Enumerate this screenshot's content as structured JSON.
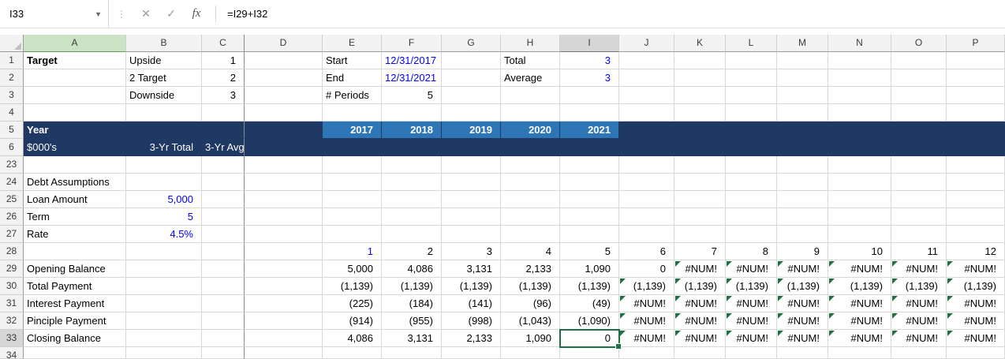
{
  "formula_bar": {
    "name_box": "I33",
    "separator_icon": "⋮",
    "cancel_icon": "✕",
    "enter_icon": "✓",
    "fx_icon": "fx",
    "formula": "=I29+I32"
  },
  "colors": {
    "banner": "#1F3864",
    "year_header": "#2E75B6",
    "input_blue": "#0000FF",
    "selection_green": "#1E7145",
    "error_flag_green": "#1E7145",
    "gridline": "#D8D8D8"
  },
  "sheet": {
    "columns": [
      "A",
      "B",
      "C",
      "D",
      "E",
      "F",
      "G",
      "H",
      "I",
      "J",
      "K",
      "L",
      "M",
      "N",
      "O",
      "P"
    ],
    "selected_cell": {
      "ref": "I33",
      "column": "I",
      "row": "33"
    },
    "highlighted_green_column": "A",
    "rows": [
      {
        "n": "1",
        "cells": [
          {
            "col": "A",
            "text": "Target",
            "cls": "b"
          },
          {
            "col": "B",
            "text": "Upside",
            "cls": ""
          },
          {
            "col": "C",
            "text": "1",
            "cls": "r"
          },
          {
            "col": "E",
            "text": "Start",
            "cls": ""
          },
          {
            "col": "F",
            "text": "12/31/2017",
            "cls": "r blu"
          },
          {
            "col": "H",
            "text": "Total",
            "cls": ""
          },
          {
            "col": "I",
            "text": "3",
            "cls": "r blu"
          }
        ]
      },
      {
        "n": "2",
        "cells": [
          {
            "col": "B",
            "text": "2 Target",
            "cls": ""
          },
          {
            "col": "C",
            "text": "2",
            "cls": "r"
          },
          {
            "col": "E",
            "text": "End",
            "cls": ""
          },
          {
            "col": "F",
            "text": "12/31/2021",
            "cls": "r blu"
          },
          {
            "col": "H",
            "text": "Average",
            "cls": ""
          },
          {
            "col": "I",
            "text": "3",
            "cls": "r blu"
          }
        ]
      },
      {
        "n": "3",
        "cells": [
          {
            "col": "B",
            "text": "Downside",
            "cls": ""
          },
          {
            "col": "C",
            "text": "3",
            "cls": "r"
          },
          {
            "col": "E",
            "text": "# Periods",
            "cls": ""
          },
          {
            "col": "F",
            "text": "5",
            "cls": "r"
          }
        ]
      },
      {
        "n": "4",
        "cells": []
      },
      {
        "n": "5",
        "row_cls": "banner",
        "cells": [
          {
            "col": "A",
            "text": "Year",
            "cls": "b w"
          },
          {
            "col": "E",
            "text": "2017",
            "cls": "year r b w"
          },
          {
            "col": "F",
            "text": "2018",
            "cls": "year r b w"
          },
          {
            "col": "G",
            "text": "2019",
            "cls": "year r b w"
          },
          {
            "col": "H",
            "text": "2020",
            "cls": "year r b w"
          },
          {
            "col": "I",
            "text": "2021",
            "cls": "year r b w"
          }
        ]
      },
      {
        "n": "6",
        "row_cls": "banner",
        "cells": [
          {
            "col": "A",
            "text": "$000's",
            "cls": "w"
          },
          {
            "col": "B",
            "text": "3-Yr Total",
            "cls": "r w"
          },
          {
            "col": "C",
            "text": "3-Yr Avg",
            "cls": "r w"
          }
        ]
      },
      {
        "n": "23",
        "cells": []
      },
      {
        "n": "24",
        "cells": [
          {
            "col": "A",
            "text": "Debt Assumptions",
            "cls": ""
          }
        ]
      },
      {
        "n": "25",
        "cells": [
          {
            "col": "A",
            "text": "Loan Amount",
            "cls": ""
          },
          {
            "col": "B",
            "text": "5,000",
            "cls": "r blu"
          }
        ]
      },
      {
        "n": "26",
        "cells": [
          {
            "col": "A",
            "text": "Term",
            "cls": ""
          },
          {
            "col": "B",
            "text": "5",
            "cls": "r blu"
          }
        ]
      },
      {
        "n": "27",
        "cells": [
          {
            "col": "A",
            "text": "Rate",
            "cls": ""
          },
          {
            "col": "B",
            "text": "4.5%",
            "cls": "r blu"
          }
        ]
      },
      {
        "n": "28",
        "cells": [
          {
            "col": "E",
            "text": "1",
            "cls": "r blu"
          },
          {
            "col": "F",
            "text": "2",
            "cls": "r"
          },
          {
            "col": "G",
            "text": "3",
            "cls": "r"
          },
          {
            "col": "H",
            "text": "4",
            "cls": "r"
          },
          {
            "col": "I",
            "text": "5",
            "cls": "r"
          },
          {
            "col": "J",
            "text": "6",
            "cls": "r"
          },
          {
            "col": "K",
            "text": "7",
            "cls": "r"
          },
          {
            "col": "L",
            "text": "8",
            "cls": "r"
          },
          {
            "col": "M",
            "text": "9",
            "cls": "r"
          },
          {
            "col": "N",
            "text": "10",
            "cls": "r"
          },
          {
            "col": "O",
            "text": "11",
            "cls": "r"
          },
          {
            "col": "P",
            "text": "12",
            "cls": "r"
          }
        ]
      },
      {
        "n": "29",
        "cells": [
          {
            "col": "A",
            "text": "Opening Balance",
            "cls": ""
          },
          {
            "col": "E",
            "text": "5,000",
            "cls": "r"
          },
          {
            "col": "F",
            "text": "4,086",
            "cls": "r"
          },
          {
            "col": "G",
            "text": "3,131",
            "cls": "r"
          },
          {
            "col": "H",
            "text": "2,133",
            "cls": "r"
          },
          {
            "col": "I",
            "text": "1,090",
            "cls": "r"
          },
          {
            "col": "J",
            "text": "0",
            "cls": "r"
          },
          {
            "col": "K",
            "text": "#NUM!",
            "cls": "r",
            "flag": true
          },
          {
            "col": "L",
            "text": "#NUM!",
            "cls": "r",
            "flag": true
          },
          {
            "col": "M",
            "text": "#NUM!",
            "cls": "r",
            "flag": true
          },
          {
            "col": "N",
            "text": "#NUM!",
            "cls": "r",
            "flag": true
          },
          {
            "col": "O",
            "text": "#NUM!",
            "cls": "r",
            "flag": true
          },
          {
            "col": "P",
            "text": "#NUM!",
            "cls": "r",
            "flag": true
          }
        ]
      },
      {
        "n": "30",
        "cells": [
          {
            "col": "A",
            "text": "Total Payment",
            "cls": ""
          },
          {
            "col": "E",
            "text": "(1,139)",
            "cls": "r"
          },
          {
            "col": "F",
            "text": "(1,139)",
            "cls": "r"
          },
          {
            "col": "G",
            "text": "(1,139)",
            "cls": "r"
          },
          {
            "col": "H",
            "text": "(1,139)",
            "cls": "r"
          },
          {
            "col": "I",
            "text": "(1,139)",
            "cls": "r"
          },
          {
            "col": "J",
            "text": "(1,139)",
            "cls": "r",
            "flag": true
          },
          {
            "col": "K",
            "text": "(1,139)",
            "cls": "r",
            "flag": true
          },
          {
            "col": "L",
            "text": "(1,139)",
            "cls": "r",
            "flag": true
          },
          {
            "col": "M",
            "text": "(1,139)",
            "cls": "r",
            "flag": true
          },
          {
            "col": "N",
            "text": "(1,139)",
            "cls": "r",
            "flag": true
          },
          {
            "col": "O",
            "text": "(1,139)",
            "cls": "r",
            "flag": true
          },
          {
            "col": "P",
            "text": "(1,139)",
            "cls": "r",
            "flag": true
          }
        ]
      },
      {
        "n": "31",
        "cells": [
          {
            "col": "A",
            "text": "Interest Payment",
            "cls": ""
          },
          {
            "col": "E",
            "text": "(225)",
            "cls": "r"
          },
          {
            "col": "F",
            "text": "(184)",
            "cls": "r"
          },
          {
            "col": "G",
            "text": "(141)",
            "cls": "r"
          },
          {
            "col": "H",
            "text": "(96)",
            "cls": "r"
          },
          {
            "col": "I",
            "text": "(49)",
            "cls": "r"
          },
          {
            "col": "J",
            "text": "#NUM!",
            "cls": "r",
            "flag": true
          },
          {
            "col": "K",
            "text": "#NUM!",
            "cls": "r",
            "flag": true
          },
          {
            "col": "L",
            "text": "#NUM!",
            "cls": "r",
            "flag": true
          },
          {
            "col": "M",
            "text": "#NUM!",
            "cls": "r",
            "flag": true
          },
          {
            "col": "N",
            "text": "#NUM!",
            "cls": "r",
            "flag": true
          },
          {
            "col": "O",
            "text": "#NUM!",
            "cls": "r",
            "flag": true
          },
          {
            "col": "P",
            "text": "#NUM!",
            "cls": "r",
            "flag": true
          }
        ]
      },
      {
        "n": "32",
        "cells": [
          {
            "col": "A",
            "text": "Pinciple Payment",
            "cls": ""
          },
          {
            "col": "E",
            "text": "(914)",
            "cls": "r"
          },
          {
            "col": "F",
            "text": "(955)",
            "cls": "r"
          },
          {
            "col": "G",
            "text": "(998)",
            "cls": "r"
          },
          {
            "col": "H",
            "text": "(1,043)",
            "cls": "r"
          },
          {
            "col": "I",
            "text": "(1,090)",
            "cls": "r"
          },
          {
            "col": "J",
            "text": "#NUM!",
            "cls": "r",
            "flag": true
          },
          {
            "col": "K",
            "text": "#NUM!",
            "cls": "r",
            "flag": true
          },
          {
            "col": "L",
            "text": "#NUM!",
            "cls": "r",
            "flag": true
          },
          {
            "col": "M",
            "text": "#NUM!",
            "cls": "r",
            "flag": true
          },
          {
            "col": "N",
            "text": "#NUM!",
            "cls": "r",
            "flag": true
          },
          {
            "col": "O",
            "text": "#NUM!",
            "cls": "r",
            "flag": true
          },
          {
            "col": "P",
            "text": "#NUM!",
            "cls": "r",
            "flag": true
          }
        ]
      },
      {
        "n": "33",
        "cells": [
          {
            "col": "A",
            "text": "Closing Balance",
            "cls": ""
          },
          {
            "col": "E",
            "text": "4,086",
            "cls": "r"
          },
          {
            "col": "F",
            "text": "3,131",
            "cls": "r"
          },
          {
            "col": "G",
            "text": "2,133",
            "cls": "r"
          },
          {
            "col": "H",
            "text": "1,090",
            "cls": "r"
          },
          {
            "col": "I",
            "text": "0",
            "cls": "r",
            "selected": true
          },
          {
            "col": "J",
            "text": "#NUM!",
            "cls": "r",
            "flag": true
          },
          {
            "col": "K",
            "text": "#NUM!",
            "cls": "r",
            "flag": true
          },
          {
            "col": "L",
            "text": "#NUM!",
            "cls": "r",
            "flag": true
          },
          {
            "col": "M",
            "text": "#NUM!",
            "cls": "r",
            "flag": true
          },
          {
            "col": "N",
            "text": "#NUM!",
            "cls": "r",
            "flag": true
          },
          {
            "col": "O",
            "text": "#NUM!",
            "cls": "r",
            "flag": true
          },
          {
            "col": "P",
            "text": "#NUM!",
            "cls": "r",
            "flag": true
          }
        ]
      },
      {
        "n": "34",
        "partial": true,
        "cells": []
      }
    ]
  }
}
